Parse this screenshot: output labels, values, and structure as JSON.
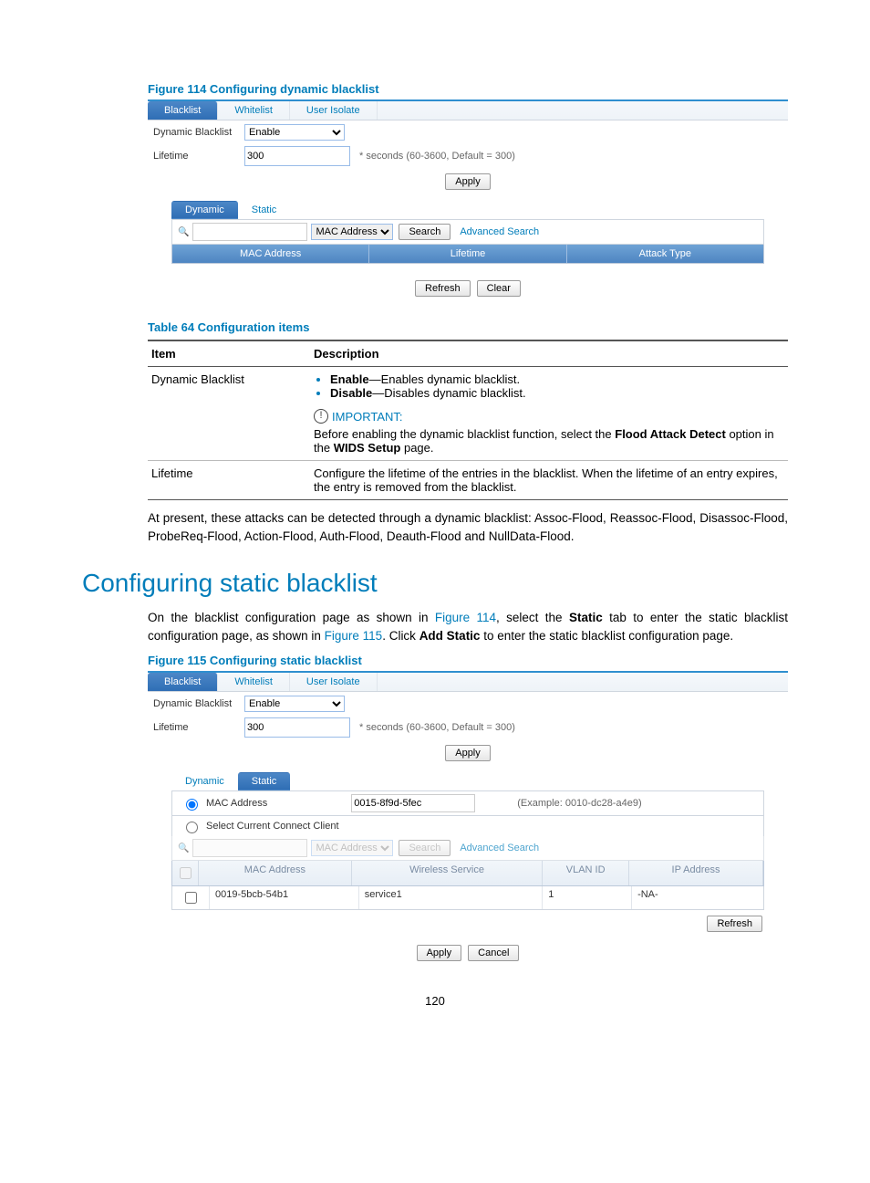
{
  "fig114_caption": "Figure 114 Configuring dynamic blacklist",
  "fig115_caption": "Figure 115 Configuring static blacklist",
  "table_caption": "Table 64 Configuration items",
  "section_title": "Configuring static blacklist",
  "page_number": "120",
  "tabs": {
    "blacklist": "Blacklist",
    "whitelist": "Whitelist",
    "userisolate": "User Isolate"
  },
  "subtabs": {
    "dynamic": "Dynamic",
    "static": "Static"
  },
  "form": {
    "dyn_label": "Dynamic Blacklist",
    "dyn_value": "Enable",
    "life_label": "Lifetime",
    "life_value": "300",
    "life_hint": "* seconds (60-3600, Default = 300)"
  },
  "buttons": {
    "apply": "Apply",
    "search": "Search",
    "refresh": "Refresh",
    "clear": "Clear",
    "cancel": "Cancel"
  },
  "search": {
    "field": "MAC Address",
    "advanced": "Advanced Search"
  },
  "grid_dyn": {
    "c1": "MAC Address",
    "c2": "Lifetime",
    "c3": "Attack Type"
  },
  "radio": {
    "mac_label": "MAC Address",
    "mac_value": "0015-8f9d-5fec",
    "mac_example": "(Example: 0010-dc28-a4e9)",
    "sel_label": "Select Current Connect Client"
  },
  "grid_static_head": {
    "c0": "",
    "c1": "MAC Address",
    "c2": "Wireless Service",
    "c3": "VLAN ID",
    "c4": "IP Address"
  },
  "grid_static_row": {
    "c1": "0019-5bcb-54b1",
    "c2": "service1",
    "c3": "1",
    "c4": "-NA-"
  },
  "desc_table": {
    "h1": "Item",
    "h2": "Description",
    "r1_item": "Dynamic Blacklist",
    "r1_li1a": "Enable",
    "r1_li1b": "—Enables dynamic blacklist.",
    "r1_li2a": "Disable",
    "r1_li2b": "—Disables dynamic blacklist.",
    "r1_imp": "IMPORTANT:",
    "r1_note_a": "Before enabling the dynamic blacklist function, select the ",
    "r1_note_b": "Flood Attack Detect",
    "r1_note_c": " option in the ",
    "r1_note_d": "WIDS Setup",
    "r1_note_e": " page.",
    "r2_item": "Lifetime",
    "r2_desc": "Configure the lifetime of the entries in the blacklist. When the lifetime of an entry expires, the entry is removed from the blacklist."
  },
  "para_attacks": "At present, these attacks can be detected through a dynamic blacklist: Assoc-Flood, Reassoc-Flood, Disassoc-Flood, ProbeReq-Flood, Action-Flood, Auth-Flood, Deauth-Flood and NullData-Flood.",
  "para_static_1a": "On the blacklist configuration page as shown in ",
  "para_static_1b": "Figure 114",
  "para_static_1c": ", select the ",
  "para_static_1d": "Static",
  "para_static_1e": " tab to enter the static blacklist configuration page, as shown in ",
  "para_static_1f": "Figure 115",
  "para_static_1g": ". Click ",
  "para_static_1h": "Add Static",
  "para_static_1i": " to enter the static blacklist configuration page."
}
